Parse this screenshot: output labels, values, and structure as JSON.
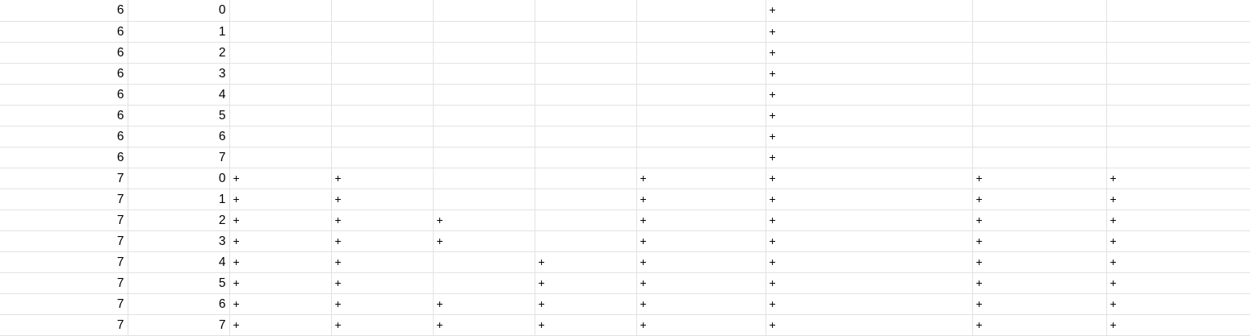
{
  "sheet": {
    "rows": [
      [
        "6",
        "0",
        "",
        "",
        "",
        "",
        "",
        "+",
        "",
        ""
      ],
      [
        "6",
        "1",
        "",
        "",
        "",
        "",
        "",
        "+",
        "",
        ""
      ],
      [
        "6",
        "2",
        "",
        "",
        "",
        "",
        "",
        "+",
        "",
        ""
      ],
      [
        "6",
        "3",
        "",
        "",
        "",
        "",
        "",
        "+",
        "",
        ""
      ],
      [
        "6",
        "4",
        "",
        "",
        "",
        "",
        "",
        "+",
        "",
        ""
      ],
      [
        "6",
        "5",
        "",
        "",
        "",
        "",
        "",
        "+",
        "",
        ""
      ],
      [
        "6",
        "6",
        "",
        "",
        "",
        "",
        "",
        "+",
        "",
        ""
      ],
      [
        "6",
        "7",
        "",
        "",
        "",
        "",
        "",
        "+",
        "",
        ""
      ],
      [
        "7",
        "0",
        "+",
        "+",
        "",
        "",
        "+",
        "+",
        "+",
        "+"
      ],
      [
        "7",
        "1",
        "+",
        "+",
        "",
        "",
        "+",
        "+",
        "+",
        "+"
      ],
      [
        "7",
        "2",
        "+",
        "+",
        "+",
        "",
        "+",
        "+",
        "+",
        "+"
      ],
      [
        "7",
        "3",
        "+",
        "+",
        "+",
        "",
        "+",
        "+",
        "+",
        "+"
      ],
      [
        "7",
        "4",
        "+",
        "+",
        "",
        "+",
        "+",
        "+",
        "+",
        "+"
      ],
      [
        "7",
        "5",
        "+",
        "+",
        "",
        "+",
        "+",
        "+",
        "+",
        "+"
      ],
      [
        "7",
        "6",
        "+",
        "+",
        "+",
        "+",
        "+",
        "+",
        "+",
        "+"
      ],
      [
        "7",
        "7",
        "+",
        "+",
        "+",
        "+",
        "+",
        "+",
        "+",
        "+"
      ]
    ]
  }
}
